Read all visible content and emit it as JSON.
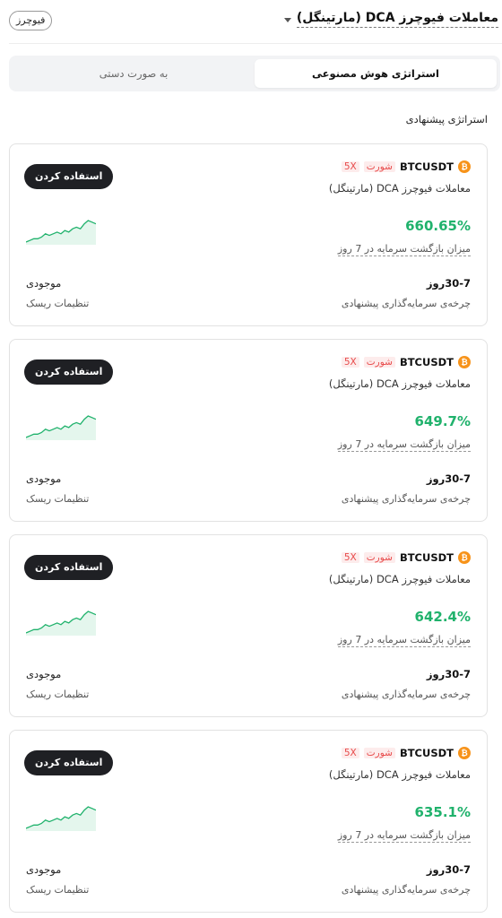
{
  "header": {
    "title": "معاملات فیوچرز DCA (مارتینگل)",
    "market_chip": "فیوچرز"
  },
  "tabs": [
    {
      "label": "استراتژی هوش مصنوعی",
      "active": true
    },
    {
      "label": "به صورت دستی",
      "active": false
    }
  ],
  "section_title": "استراتژی پیشنهادی",
  "colors": {
    "accent_green": "#20b26c",
    "short_red": "#e84c4c",
    "button_dark": "#1f2024",
    "btc_orange": "#f7931a"
  },
  "cards": [
    {
      "pair": "BTCUSDT",
      "side": "شورت",
      "leverage": "5X",
      "strategy": "معاملات فیوچرز DCA (مارتینگل)",
      "button": "استفاده کردن",
      "roi": "660.65%",
      "roi_label": "میزان بازگشت سرمایه در 7 روز",
      "cycle": "30-7روز",
      "cycle_label": "چرخه‌ی سرمایه‌گذاری پیشنهادی",
      "risk": "موجودی",
      "risk_label": "تنظیمات ریسک",
      "spark": [
        10,
        11,
        12,
        12,
        13,
        15,
        14,
        15,
        16,
        15,
        17,
        16,
        18,
        19,
        18,
        21,
        23,
        22,
        21
      ]
    },
    {
      "pair": "BTCUSDT",
      "side": "شورت",
      "leverage": "5X",
      "strategy": "معاملات فیوچرز DCA (مارتینگل)",
      "button": "استفاده کردن",
      "roi": "649.7%",
      "roi_label": "میزان بازگشت سرمایه در 7 روز",
      "cycle": "30-7روز",
      "cycle_label": "چرخه‌ی سرمایه‌گذاری پیشنهادی",
      "risk": "موجودی",
      "risk_label": "تنظیمات ریسک",
      "spark": [
        10,
        11,
        12,
        12,
        13,
        15,
        14,
        15,
        16,
        15,
        17,
        16,
        18,
        19,
        18,
        21,
        23,
        22,
        21
      ]
    },
    {
      "pair": "BTCUSDT",
      "side": "شورت",
      "leverage": "5X",
      "strategy": "معاملات فیوچرز DCA (مارتینگل)",
      "button": "استفاده کردن",
      "roi": "642.4%",
      "roi_label": "میزان بازگشت سرمایه در 7 روز",
      "cycle": "30-7روز",
      "cycle_label": "چرخه‌ی سرمایه‌گذاری پیشنهادی",
      "risk": "موجودی",
      "risk_label": "تنظیمات ریسک",
      "spark": [
        10,
        11,
        12,
        12,
        13,
        15,
        14,
        15,
        16,
        15,
        17,
        16,
        18,
        19,
        18,
        21,
        23,
        22,
        21
      ]
    },
    {
      "pair": "BTCUSDT",
      "side": "شورت",
      "leverage": "5X",
      "strategy": "معاملات فیوچرز DCA (مارتینگل)",
      "button": "استفاده کردن",
      "roi": "635.1%",
      "roi_label": "میزان بازگشت سرمایه در 7 روز",
      "cycle": "30-7روز",
      "cycle_label": "چرخه‌ی سرمایه‌گذاری پیشنهادی",
      "risk": "موجودی",
      "risk_label": "تنظیمات ریسک",
      "spark": [
        10,
        11,
        12,
        12,
        13,
        15,
        14,
        15,
        16,
        15,
        17,
        16,
        18,
        19,
        18,
        21,
        23,
        22,
        21
      ]
    }
  ]
}
